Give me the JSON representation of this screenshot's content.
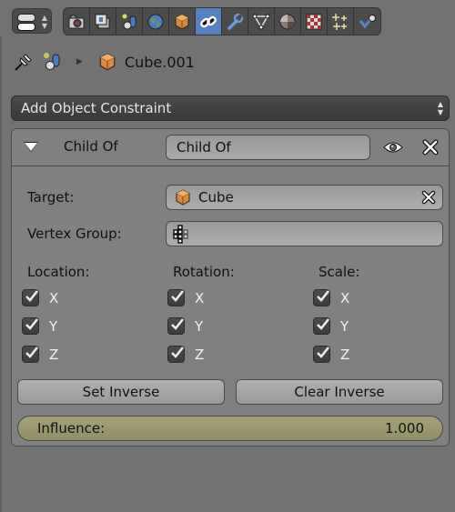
{
  "header": {
    "context_switch_icon": "view-context-switch-icon",
    "tabs": [
      {
        "name": "render",
        "icon": "camera-icon",
        "active": false
      },
      {
        "name": "render-layers",
        "icon": "render-layers-icon",
        "active": false
      },
      {
        "name": "scene",
        "icon": "scene-icon",
        "active": false
      },
      {
        "name": "world",
        "icon": "world-icon",
        "active": false
      },
      {
        "name": "object",
        "icon": "cube-icon",
        "active": false
      },
      {
        "name": "constraints",
        "icon": "link-icon",
        "active": true
      },
      {
        "name": "modifiers",
        "icon": "wrench-icon",
        "active": false
      },
      {
        "name": "data",
        "icon": "mesh-data-icon",
        "active": false
      },
      {
        "name": "material",
        "icon": "material-sphere-icon",
        "active": false
      },
      {
        "name": "texture",
        "icon": "texture-checker-icon",
        "active": false
      },
      {
        "name": "particles",
        "icon": "particles-icon",
        "active": false
      },
      {
        "name": "physics",
        "icon": "physics-icon",
        "active": false
      }
    ],
    "accent": "#5680c2"
  },
  "breadcrumb": {
    "pin_icon": "pin-icon",
    "scene_icon": "scene-icon",
    "object_name": "Cube.001"
  },
  "add_constraint": {
    "label": "Add Object Constraint"
  },
  "constraint": {
    "type_label": "Child Of",
    "name_value": "Child Of",
    "target_label": "Target:",
    "target_value": "Cube",
    "vertex_group_label": "Vertex Group:",
    "vertex_group_value": "",
    "location": {
      "label": "Location:",
      "x": {
        "label": "X",
        "checked": true
      },
      "y": {
        "label": "Y",
        "checked": true
      },
      "z": {
        "label": "Z",
        "checked": true
      }
    },
    "rotation": {
      "label": "Rotation:",
      "x": {
        "label": "X",
        "checked": true
      },
      "y": {
        "label": "Y",
        "checked": true
      },
      "z": {
        "label": "Z",
        "checked": true
      }
    },
    "scale": {
      "label": "Scale:",
      "x": {
        "label": "X",
        "checked": true
      },
      "y": {
        "label": "Y",
        "checked": true
      },
      "z": {
        "label": "Z",
        "checked": true
      }
    },
    "set_inverse_label": "Set Inverse",
    "clear_inverse_label": "Clear Inverse",
    "influence_label": "Influence:",
    "influence_value": "1.000",
    "influence_color": "#9b9a70"
  }
}
